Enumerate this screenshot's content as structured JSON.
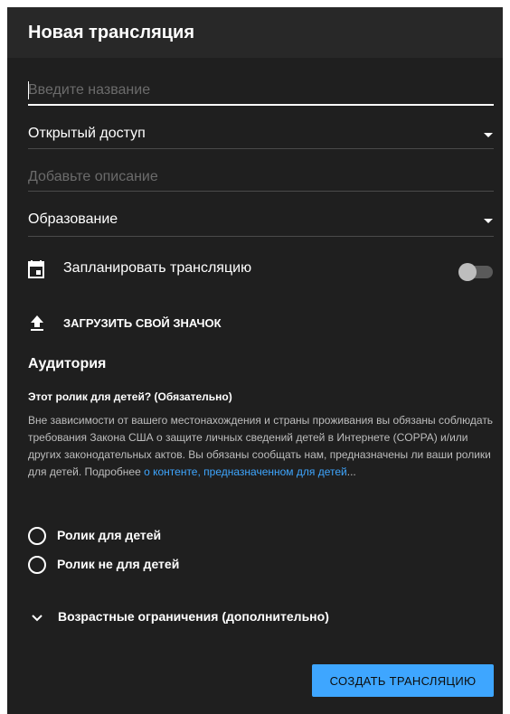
{
  "dialog": {
    "title": "Новая трансляция"
  },
  "form": {
    "name": {
      "value": "",
      "placeholder": "Введите название"
    },
    "privacy": {
      "value": "Открытый доступ"
    },
    "description": {
      "placeholder": "Добавьте описание"
    },
    "category": {
      "value": "Образование"
    },
    "schedule": {
      "label": "Запланировать трансляцию",
      "enabled": false
    },
    "upload_thumbnail_label": "ЗАГРУЗИТЬ СВОЙ ЗНАЧОК"
  },
  "audience": {
    "title": "Аудитория",
    "question": "Этот ролик для детей? (Обязательно)",
    "info_text": "Вне зависимости от вашего местонахождения и страны проживания вы обязаны соблюдать требования Закона США о защите личных сведений детей в Интернете (COPPA) и/или других законодательных актов. Вы обязаны сообщать нам, предназначены ли ваши ролики для детей. Подробнее ",
    "info_link": "о контенте, предназначенном для детей",
    "info_suffix": "...",
    "options": [
      {
        "label": "Ролик для детей",
        "selected": false
      },
      {
        "label": "Ролик не для детей",
        "selected": false
      }
    ]
  },
  "age_restrictions_label": "Возрастные ограничения (дополнительно)",
  "actions": {
    "create_label": "СОЗДАТЬ ТРАНСЛЯЦИЮ"
  },
  "icons": {
    "calendar": "calendar-icon",
    "upload": "upload-icon",
    "dropdown": "dropdown-arrow-icon",
    "expand": "chevron-down-icon"
  },
  "colors": {
    "background": "#1f1f1f",
    "header": "#282828",
    "accent": "#3ea6ff",
    "muted_text": "#bdbdbd",
    "placeholder": "#6b6b6b",
    "divider": "#4a4a4a"
  }
}
